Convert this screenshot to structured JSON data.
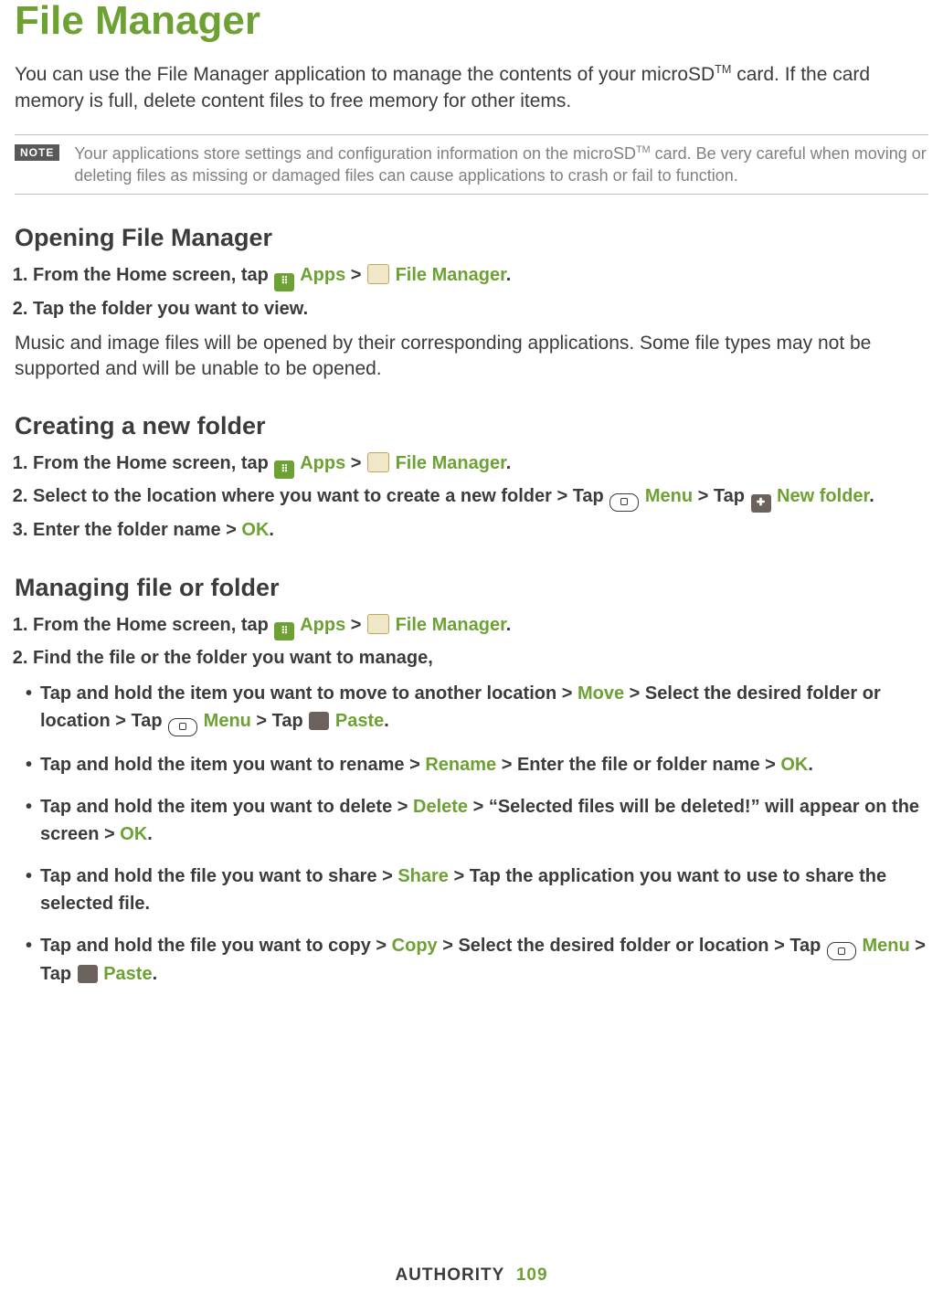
{
  "title": "File Manager",
  "intro": {
    "p1a": "You can use the File Manager application to manage the contents of your microSD",
    "tm": "TM",
    "p1b": " card. If the card memory is full, delete content files to free memory for other items."
  },
  "note": {
    "badge": "NOTE",
    "text_a": "Your applications store settings and configuration information on the microSD",
    "text_tm": "TM",
    "text_b": " card. Be very careful when moving or deleting files as missing or damaged files can cause applications to crash or fail to function."
  },
  "sections": {
    "open": {
      "heading": "Opening File Manager",
      "step1_a": "From the Home screen, tap ",
      "step1_apps": "Apps",
      "step1_gt": " > ",
      "step1_fm": "File Manager",
      "step1_dot": ".",
      "step2": "Tap the folder you want to view.",
      "after": "Music and image files will be opened by their corresponding applications. Some file types may not be supported and will be unable to be opened."
    },
    "create": {
      "heading": "Creating a new folder",
      "step1_a": "From the Home screen, tap ",
      "step1_apps": "Apps",
      "step1_gt": " > ",
      "step1_fm": "File Manager",
      "step1_dot": ".",
      "step2_a": "Select to the location where you want to create a new folder > Tap ",
      "step2_menu": "Menu",
      "step2_mid": " > Tap ",
      "step2_newfolder": "New folder",
      "step2_dot": ".",
      "step3_a": "Enter the folder name > ",
      "step3_ok": "OK",
      "step3_dot": "."
    },
    "manage": {
      "heading": "Managing file or folder",
      "step1_a": "From the Home screen, tap ",
      "step1_apps": "Apps",
      "step1_gt": " > ",
      "step1_fm": "File Manager",
      "step1_dot": ".",
      "step2": "Find the file or the folder you want to manage,",
      "b_move_a": "Tap and hold the item you want to move to another location > ",
      "b_move_kw": "Move",
      "b_move_b": " > Select the desired folder or location > Tap ",
      "b_move_menu": "Menu",
      "b_move_c": " > Tap ",
      "b_move_paste": "Paste",
      "b_move_dot": ".",
      "b_rename_a": "Tap and hold the item you want to rename > ",
      "b_rename_kw": "Rename",
      "b_rename_b": " > Enter the file or folder name > ",
      "b_rename_ok": "OK",
      "b_rename_dot": ".",
      "b_delete_a": "Tap and hold the item you want to delete > ",
      "b_delete_kw": "Delete",
      "b_delete_b": " > “Selected files will be deleted!” will appear on the screen > ",
      "b_delete_ok": "OK",
      "b_delete_dot": ".",
      "b_share_a": "Tap and hold the file you want to share > ",
      "b_share_kw": "Share",
      "b_share_b": " > Tap the application you want to use to share the selected file.",
      "b_copy_a": "Tap and hold the file you want to copy > ",
      "b_copy_kw": "Copy",
      "b_copy_b": " > Select the desired folder or location > Tap ",
      "b_copy_menu": "Menu",
      "b_copy_c": " > Tap ",
      "b_copy_paste": "Paste",
      "b_copy_dot": "."
    }
  },
  "footer": {
    "brand": "AUTHORITY",
    "page": "109"
  },
  "icons": {
    "apps_glyph": "⠿",
    "newfolder_glyph": "✚",
    "paste_glyph": "📋"
  }
}
